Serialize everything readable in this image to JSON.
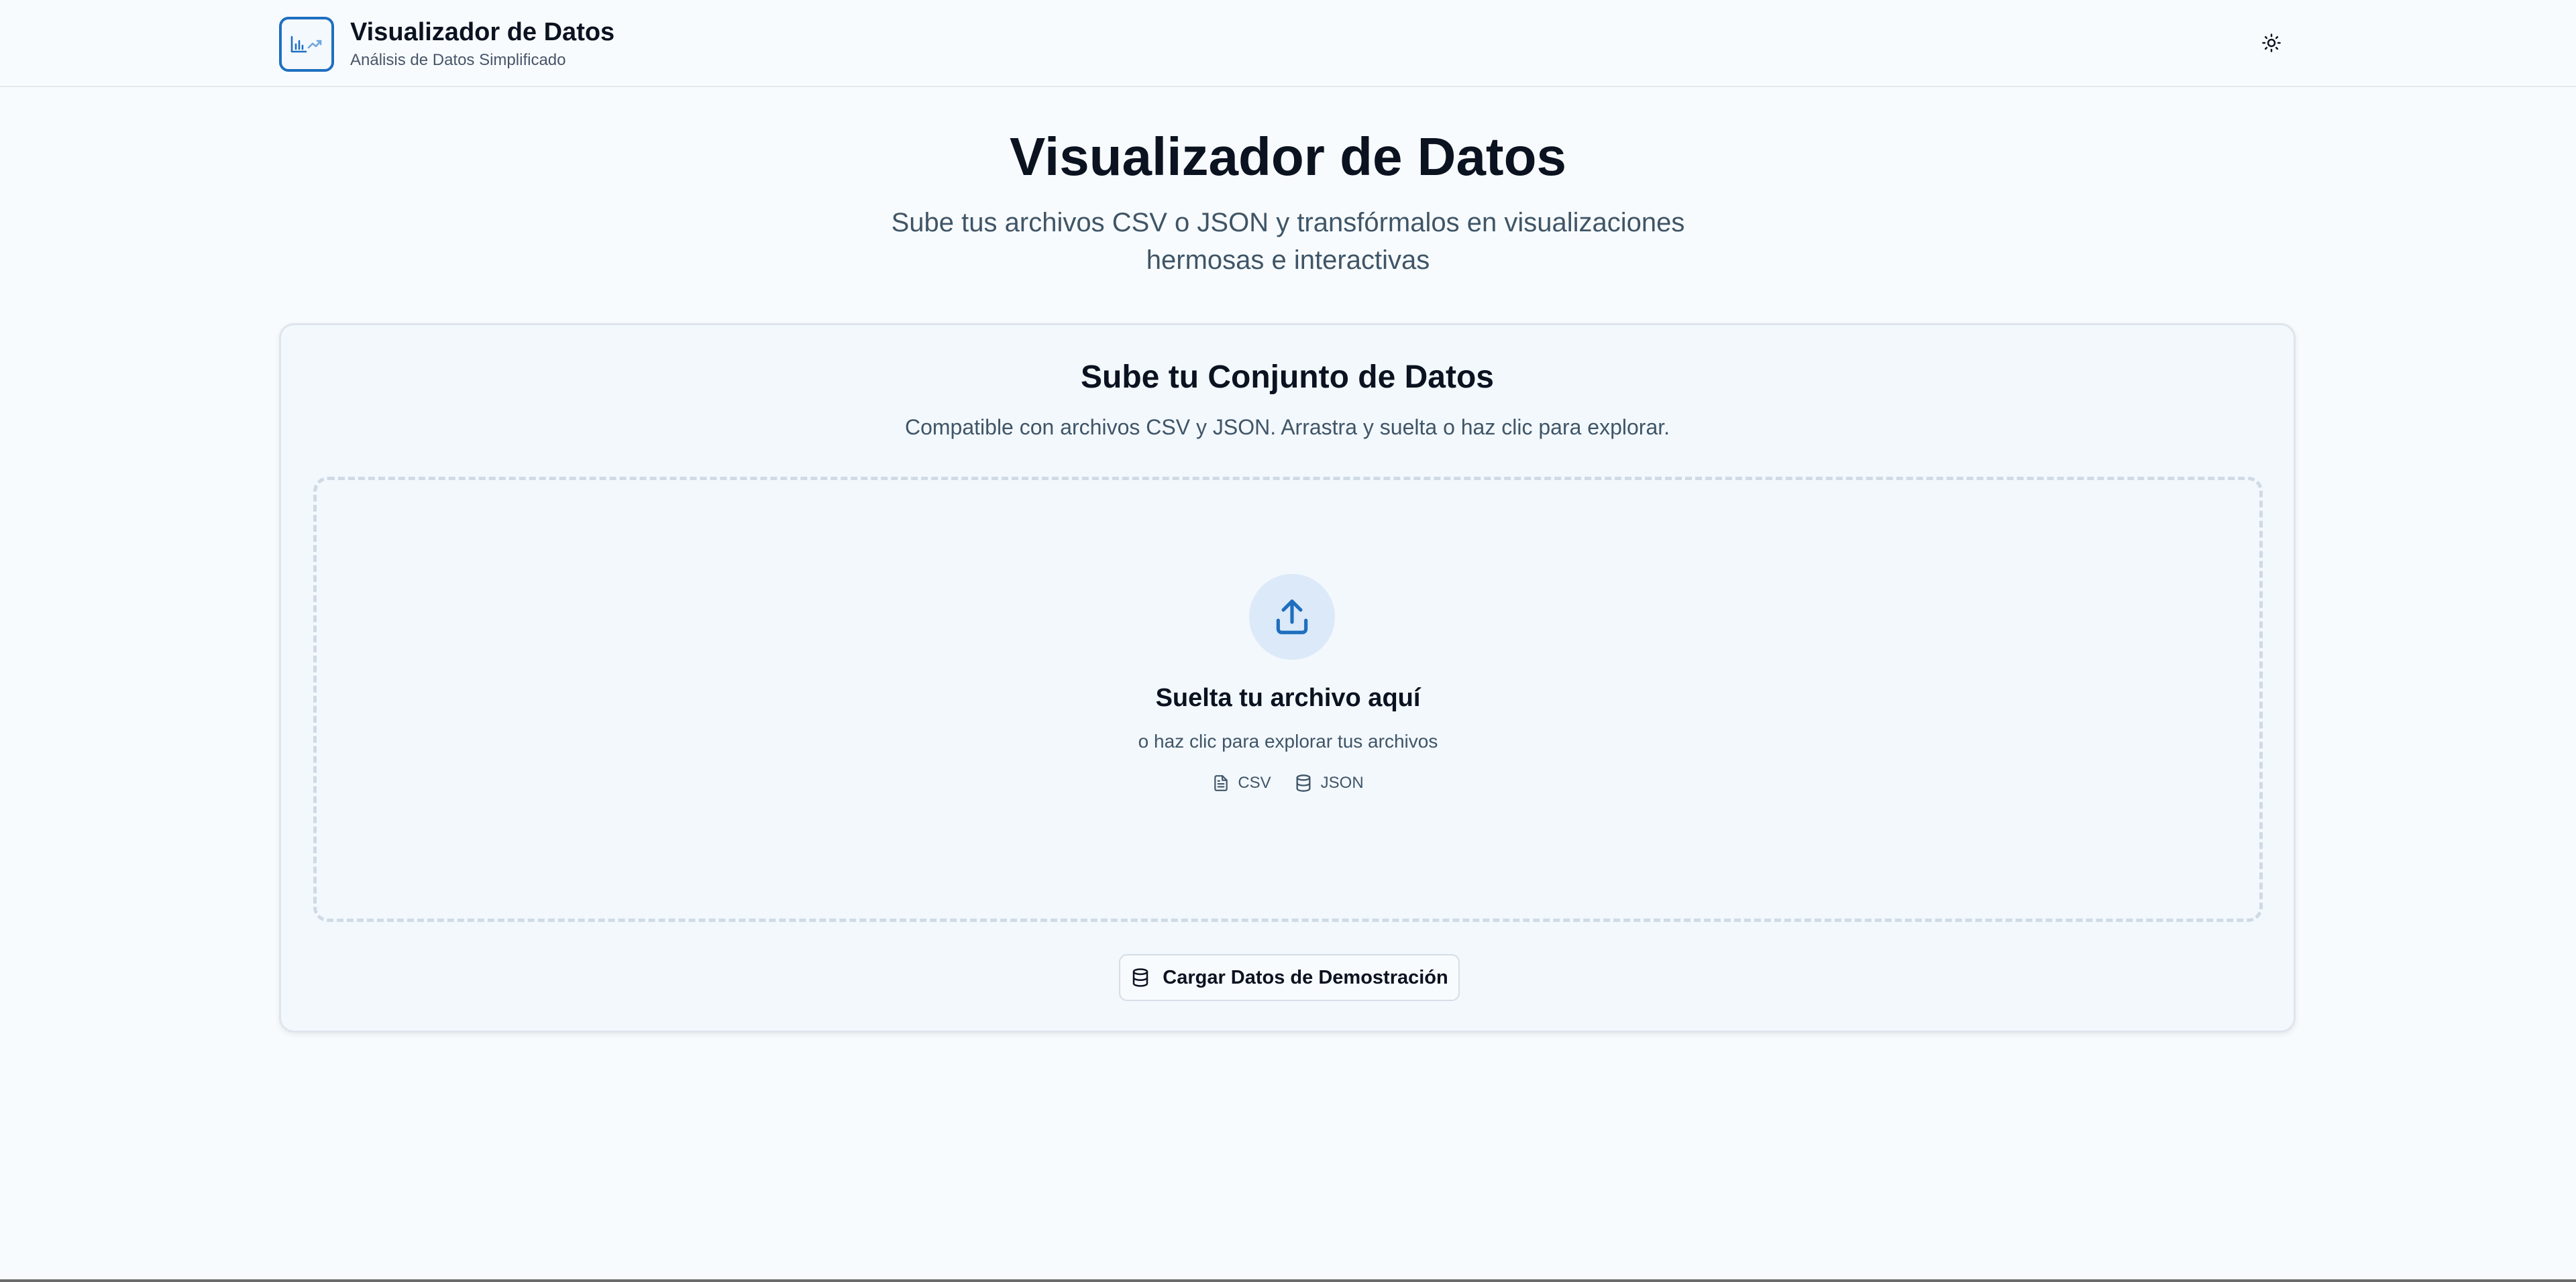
{
  "header": {
    "title": "Visualizador de Datos",
    "subtitle": "Análisis de Datos Simplificado",
    "logo_icon": "chart-logo-icon",
    "theme_toggle_icon": "sun-icon"
  },
  "hero": {
    "title": "Visualizador de Datos",
    "subtitle": "Sube tus archivos CSV o JSON y transfórmalos en visualizaciones hermosas e interactivas"
  },
  "upload_card": {
    "title": "Sube tu Conjunto de Datos",
    "description": "Compatible con archivos CSV y JSON. Arrastra y suelta o haz clic para explorar.",
    "dropzone": {
      "icon": "upload-icon",
      "title": "Suelta tu archivo aquí",
      "subtitle": "o haz clic para explorar tus archivos",
      "formats": [
        {
          "label": "CSV",
          "icon": "file-text-icon"
        },
        {
          "label": "JSON",
          "icon": "database-icon"
        }
      ]
    },
    "demo_button": {
      "label": "Cargar Datos de Demostración",
      "icon": "database-icon"
    }
  },
  "colors": {
    "accent": "#1f6fbf",
    "background": "#f8fbfd",
    "card_background": "#f3f8fd",
    "upload_circle": "#dbe9f8"
  }
}
